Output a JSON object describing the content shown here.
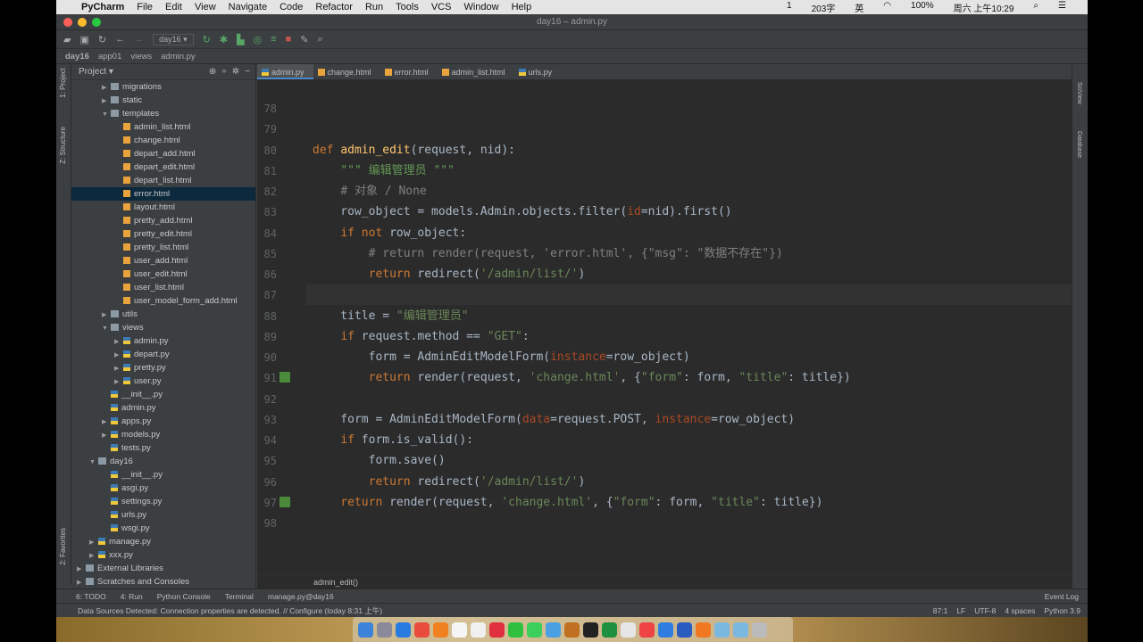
{
  "menubar": {
    "app": "PyCharm",
    "items": [
      "File",
      "Edit",
      "View",
      "Navigate",
      "Code",
      "Refactor",
      "Run",
      "Tools",
      "VCS",
      "Window",
      "Help"
    ],
    "status": [
      "1",
      "203字",
      "英",
      "100%",
      "周六 上午10:29"
    ]
  },
  "window": {
    "title": "day16 – admin.py"
  },
  "toolbar": {
    "run_config": "day16"
  },
  "breadcrumb": [
    "day16",
    "app01",
    "views",
    "admin.py"
  ],
  "project": {
    "header": "Project",
    "side_labels": [
      "1: Project",
      "Z: Structure",
      "2: Favorites"
    ],
    "items": [
      {
        "label": "migrations",
        "type": "folder",
        "depth": 2,
        "arrow": "▶"
      },
      {
        "label": "static",
        "type": "folder",
        "depth": 2,
        "arrow": "▶"
      },
      {
        "label": "templates",
        "type": "folder",
        "depth": 2,
        "arrow": "▼"
      },
      {
        "label": "admin_list.html",
        "type": "html",
        "depth": 3
      },
      {
        "label": "change.html",
        "type": "html",
        "depth": 3
      },
      {
        "label": "depart_add.html",
        "type": "html",
        "depth": 3
      },
      {
        "label": "depart_edit.html",
        "type": "html",
        "depth": 3
      },
      {
        "label": "depart_list.html",
        "type": "html",
        "depth": 3
      },
      {
        "label": "error.html",
        "type": "html",
        "depth": 3,
        "selected": true
      },
      {
        "label": "layout.html",
        "type": "html",
        "depth": 3
      },
      {
        "label": "pretty_add.html",
        "type": "html",
        "depth": 3
      },
      {
        "label": "pretty_edit.html",
        "type": "html",
        "depth": 3
      },
      {
        "label": "pretty_list.html",
        "type": "html",
        "depth": 3
      },
      {
        "label": "user_add.html",
        "type": "html",
        "depth": 3
      },
      {
        "label": "user_edit.html",
        "type": "html",
        "depth": 3
      },
      {
        "label": "user_list.html",
        "type": "html",
        "depth": 3
      },
      {
        "label": "user_model_form_add.html",
        "type": "html",
        "depth": 3
      },
      {
        "label": "utils",
        "type": "folder",
        "depth": 2,
        "arrow": "▶"
      },
      {
        "label": "views",
        "type": "folder",
        "depth": 2,
        "arrow": "▼"
      },
      {
        "label": "admin.py",
        "type": "py",
        "depth": 3,
        "arrow": "▶"
      },
      {
        "label": "depart.py",
        "type": "py",
        "depth": 3,
        "arrow": "▶"
      },
      {
        "label": "pretty.py",
        "type": "py",
        "depth": 3,
        "arrow": "▶"
      },
      {
        "label": "user.py",
        "type": "py",
        "depth": 3,
        "arrow": "▶"
      },
      {
        "label": "__init__.py",
        "type": "py",
        "depth": 2
      },
      {
        "label": "admin.py",
        "type": "py",
        "depth": 2
      },
      {
        "label": "apps.py",
        "type": "py",
        "depth": 2,
        "arrow": "▶"
      },
      {
        "label": "models.py",
        "type": "py",
        "depth": 2,
        "arrow": "▶"
      },
      {
        "label": "tests.py",
        "type": "py",
        "depth": 2
      },
      {
        "label": "day16",
        "type": "folder",
        "depth": 1,
        "arrow": "▼"
      },
      {
        "label": "__init__.py",
        "type": "py",
        "depth": 2
      },
      {
        "label": "asgi.py",
        "type": "py",
        "depth": 2
      },
      {
        "label": "settings.py",
        "type": "py",
        "depth": 2
      },
      {
        "label": "urls.py",
        "type": "py",
        "depth": 2
      },
      {
        "label": "wsgi.py",
        "type": "py",
        "depth": 2
      },
      {
        "label": "manage.py",
        "type": "py",
        "depth": 1,
        "arrow": "▶"
      },
      {
        "label": "xxx.py",
        "type": "py",
        "depth": 1,
        "arrow": "▶"
      },
      {
        "label": "External Libraries",
        "type": "folder",
        "depth": 0,
        "arrow": "▶"
      },
      {
        "label": "Scratches and Consoles",
        "type": "folder",
        "depth": 0,
        "arrow": "▶"
      }
    ]
  },
  "tabs": [
    {
      "label": "admin.py",
      "type": "py",
      "active": true
    },
    {
      "label": "change.html",
      "type": "html"
    },
    {
      "label": "error.html",
      "type": "html"
    },
    {
      "label": "admin_list.html",
      "type": "html"
    },
    {
      "label": "urls.py",
      "type": "py"
    }
  ],
  "code": [
    {
      "n": "78",
      "t": []
    },
    {
      "n": "79",
      "t": []
    },
    {
      "n": "80",
      "t": [
        [
          "def ",
          "kw"
        ],
        [
          "admin_edit",
          "fn"
        ],
        [
          "(request, nid):",
          ""
        ]
      ]
    },
    {
      "n": "81",
      "t": [
        [
          "    ",
          ""
        ],
        [
          "\"\"\" 编辑管理员 \"\"\"",
          "doc"
        ]
      ]
    },
    {
      "n": "82",
      "t": [
        [
          "    ",
          ""
        ],
        [
          "# 对象 / None",
          "cm"
        ]
      ]
    },
    {
      "n": "83",
      "t": [
        [
          "    row_object = models.Admin.objects.filter(",
          ""
        ],
        [
          "id",
          "pa"
        ],
        [
          "=nid).first()",
          ""
        ]
      ]
    },
    {
      "n": "84",
      "t": [
        [
          "    ",
          ""
        ],
        [
          "if not ",
          "kw"
        ],
        [
          "row_object:",
          ""
        ]
      ]
    },
    {
      "n": "85",
      "t": [
        [
          "        ",
          ""
        ],
        [
          "# return render(request, 'error.html', {\"msg\": \"数据不存在\"})",
          "cm"
        ]
      ]
    },
    {
      "n": "86",
      "t": [
        [
          "        ",
          ""
        ],
        [
          "return ",
          "kw"
        ],
        [
          "redirect(",
          ""
        ],
        [
          "'/admin/list/'",
          "str"
        ],
        [
          ")",
          ""
        ]
      ]
    },
    {
      "n": "87",
      "t": [],
      "current": true
    },
    {
      "n": "88",
      "t": [
        [
          "    title = ",
          ""
        ],
        [
          "\"编辑管理员\"",
          "str"
        ]
      ]
    },
    {
      "n": "89",
      "t": [
        [
          "    ",
          ""
        ],
        [
          "if ",
          "kw"
        ],
        [
          "request.method == ",
          ""
        ],
        [
          "\"GET\"",
          "str"
        ],
        [
          ":",
          ""
        ]
      ]
    },
    {
      "n": "90",
      "t": [
        [
          "        form = AdminEditModelForm(",
          ""
        ],
        [
          "instance",
          "pa"
        ],
        [
          "=row_object)",
          ""
        ]
      ]
    },
    {
      "n": "91",
      "t": [
        [
          "        ",
          ""
        ],
        [
          "return ",
          "kw"
        ],
        [
          "render(request, ",
          ""
        ],
        [
          "'change.html'",
          "str"
        ],
        [
          ", {",
          ""
        ],
        [
          "\"form\"",
          "str"
        ],
        [
          ": form, ",
          ""
        ],
        [
          "\"title\"",
          "str"
        ],
        [
          ": title})",
          ""
        ]
      ]
    },
    {
      "n": "92",
      "t": []
    },
    {
      "n": "93",
      "t": [
        [
          "    form = AdminEditModelForm(",
          ""
        ],
        [
          "data",
          "pa"
        ],
        [
          "=request.POST, ",
          ""
        ],
        [
          "instance",
          "pa"
        ],
        [
          "=row_object)",
          ""
        ]
      ]
    },
    {
      "n": "94",
      "t": [
        [
          "    ",
          ""
        ],
        [
          "if ",
          "kw"
        ],
        [
          "form.is_valid():",
          ""
        ]
      ]
    },
    {
      "n": "95",
      "t": [
        [
          "        form.save()",
          ""
        ]
      ]
    },
    {
      "n": "96",
      "t": [
        [
          "        ",
          ""
        ],
        [
          "return ",
          "kw"
        ],
        [
          "redirect(",
          ""
        ],
        [
          "'/admin/list/'",
          "str"
        ],
        [
          ")",
          ""
        ]
      ]
    },
    {
      "n": "97",
      "t": [
        [
          "    ",
          ""
        ],
        [
          "return ",
          "kw"
        ],
        [
          "render(request, ",
          ""
        ],
        [
          "'change.html'",
          "str"
        ],
        [
          ", {",
          ""
        ],
        [
          "\"form\"",
          "str"
        ],
        [
          ": form, ",
          ""
        ],
        [
          "\"title\"",
          "str"
        ],
        [
          ": title})",
          ""
        ]
      ]
    },
    {
      "n": "98",
      "t": []
    }
  ],
  "editor_breadcrumb": "admin_edit()",
  "right_strip": [
    "SciView",
    "Database"
  ],
  "tool_windows": [
    "6: TODO",
    "4: Run",
    "Python Console",
    "Terminal",
    "manage.py@day16"
  ],
  "event_log": "Event Log",
  "status": {
    "message": "Data Sources Detected: Connection properties are detected. // Configure (today 8:31 上午)",
    "position": "87:1",
    "line_sep": "LF",
    "encoding": "UTF-8",
    "indent": "4 spaces",
    "interpreter": "Python 3.9"
  },
  "dock_colors": [
    "#3b82d8",
    "#8a8a9a",
    "#2a7be0",
    "#e94c3c",
    "#f08020",
    "#f5f5f5",
    "#f0f0f0",
    "#e03040",
    "#30c040",
    "#3ccf5c",
    "#4aa0e0",
    "#c07020",
    "#222",
    "#1f8f40",
    "#e6e6e6",
    "#e44",
    "#2f7de0",
    "#2a5bbf",
    "#f07820",
    "#7ab8e0",
    "#7ab8e0",
    "#bbb"
  ]
}
